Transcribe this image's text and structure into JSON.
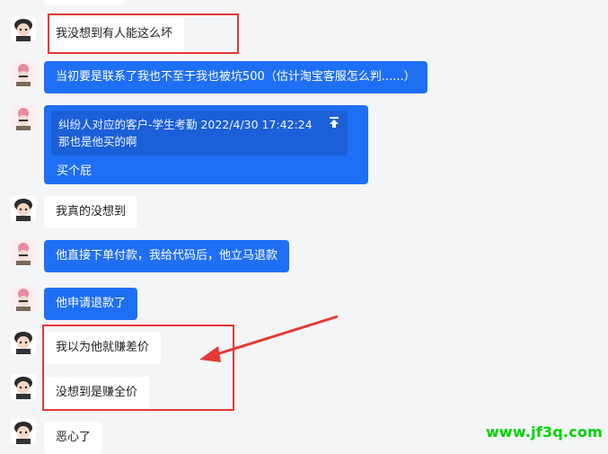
{
  "messages": [
    {
      "side": "in",
      "style": "white",
      "text": "我没想到有人能这么坏"
    },
    {
      "side": "out",
      "style": "blue",
      "text": "当初要是联系了我也不至于我也被坑500（估计淘宝客服怎么判......）"
    },
    {
      "side": "out",
      "style": "blue",
      "quote": {
        "line1": "纠纷人对应的客户-学生考勤  2022/4/30 17:42:24",
        "line2": "那也是他买的啊"
      },
      "text": "买个屁"
    },
    {
      "side": "in",
      "style": "white",
      "text": "我真的没想到"
    },
    {
      "side": "out",
      "style": "blue",
      "text": "他直接下单付款，我给代码后，他立马退款"
    },
    {
      "side": "out",
      "style": "blue",
      "text": "他申请退款了"
    },
    {
      "side": "in",
      "style": "white",
      "text": "我以为他就赚差价"
    },
    {
      "side": "in",
      "style": "white",
      "text": "没想到是赚全价"
    },
    {
      "side": "in",
      "style": "white",
      "text": "恶心了"
    }
  ],
  "icons": {
    "quote_jump": "jump-to-top-icon"
  },
  "colors": {
    "bubble_blue": "#1f6ff5",
    "bubble_white": "#ffffff",
    "annotation_red": "#e53935",
    "watermark_green": "#00d400"
  },
  "watermark": "www.jf3q.com"
}
